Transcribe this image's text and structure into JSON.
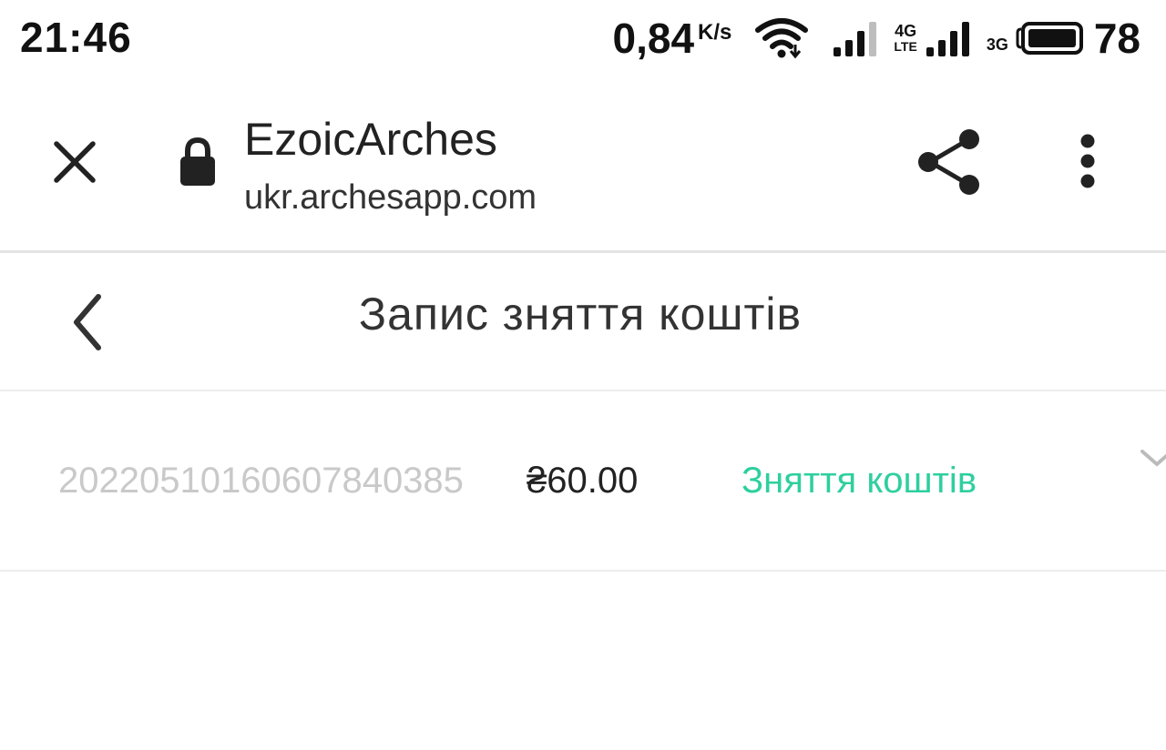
{
  "status_bar": {
    "time": "21:46",
    "net_speed": "0,84",
    "net_speed_unit": "K/s",
    "network_4g": "4G",
    "network_lte": "LTE",
    "network_3g": "3G",
    "battery_level": "78",
    "icons": [
      "wifi-icon",
      "signal-icon",
      "signal-icon",
      "battery-icon"
    ]
  },
  "browser": {
    "title": "EzoicArches",
    "url": "ukr.archesapp.com",
    "icons": [
      "close-icon",
      "lock-icon",
      "share-icon",
      "more-vert-icon"
    ]
  },
  "page": {
    "title": "Запис зняття коштів",
    "back_icon": "chevron-left-icon"
  },
  "records": [
    {
      "id": "202205101606078403​85",
      "amount": "₴60.00",
      "type": "Зняття коштів",
      "type_color": "#2ecf9f",
      "expand_icon": "chevron-down-icon"
    }
  ],
  "colors": {
    "accent": "#2ecf9f",
    "muted_text": "#c9c9c9",
    "divider": "#ededed"
  }
}
